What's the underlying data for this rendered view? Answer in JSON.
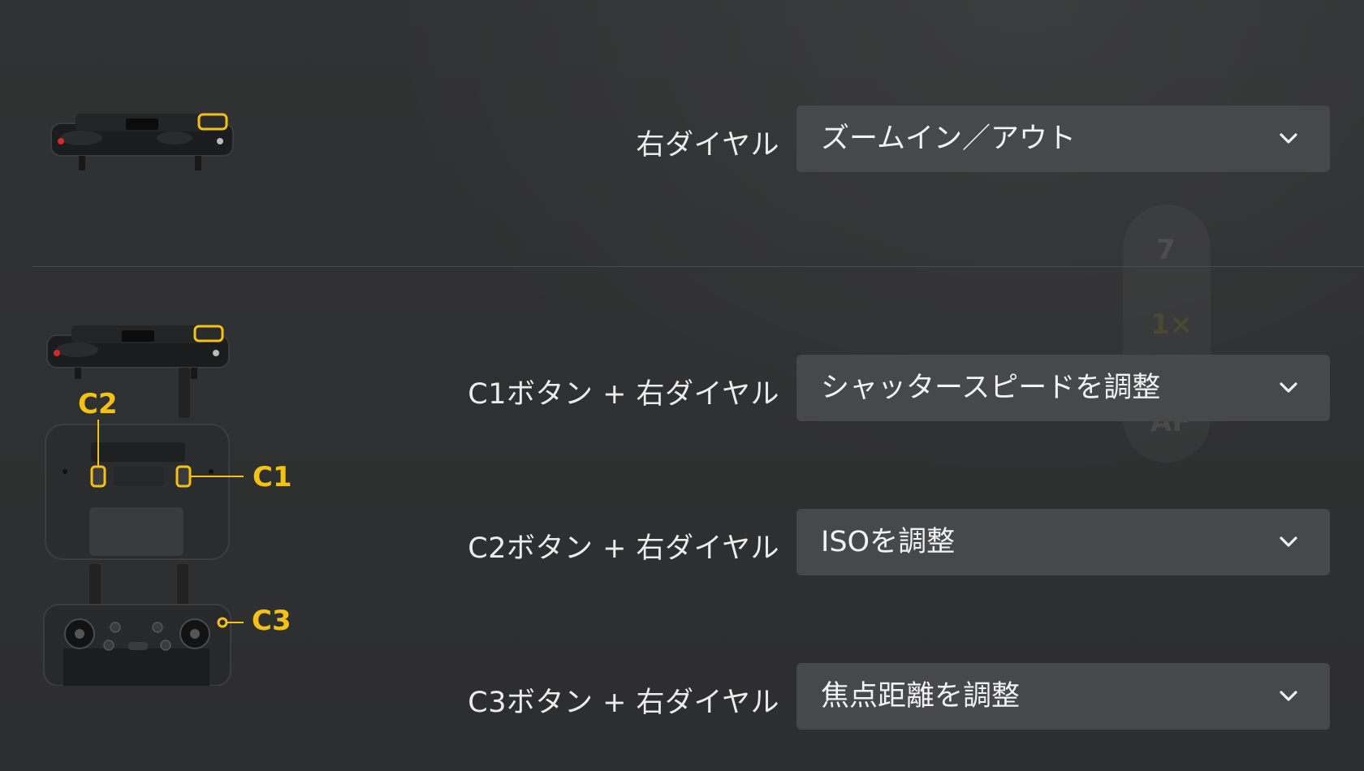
{
  "rows": [
    {
      "label": "右ダイヤル",
      "value": "ズームイン／アウト"
    },
    {
      "label": "C1ボタン + 右ダイヤル",
      "value": "シャッタースピードを調整"
    },
    {
      "label": "C2ボタン + 右ダイヤル",
      "value": "ISOを調整"
    },
    {
      "label": "C3ボタン + 右ダイヤル",
      "value": "焦点距離を調整"
    }
  ],
  "callouts": {
    "c1": "C1",
    "c2": "C2",
    "c3": "C3"
  },
  "background_ghost": {
    "top": "7",
    "middle": "1×",
    "bottom": "AF"
  },
  "colors": {
    "highlight": "#f3c214",
    "dropdown_bg": "#47484a",
    "page_bg": "#2e2f30"
  },
  "icons": {
    "dropdown": "chevron-down-icon"
  }
}
